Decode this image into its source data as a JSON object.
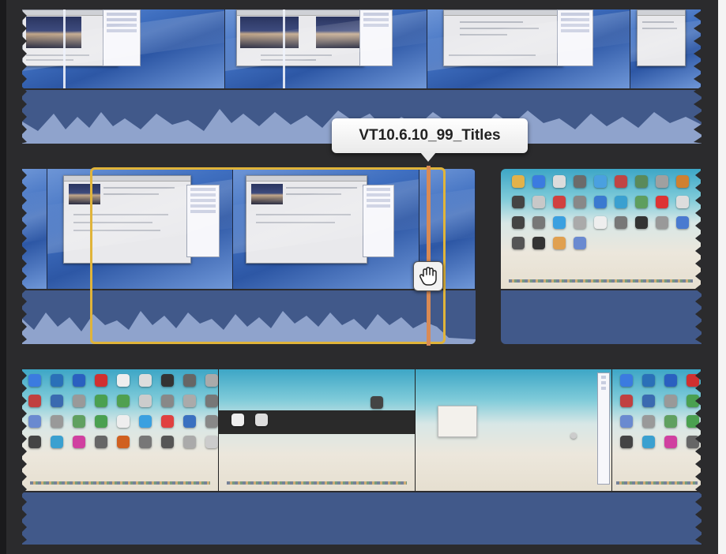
{
  "tooltip": {
    "clip_name": "VT10.6.10_99_Titles"
  },
  "icons": {
    "cursor": "grab-hand-cursor",
    "playhead": "playhead-marker"
  },
  "colors": {
    "background": "#2b2b2d",
    "audio_track": "#41598a",
    "waveform": "#8fa3cc",
    "selection": "#e0b43a",
    "playhead": "#d98a55"
  }
}
